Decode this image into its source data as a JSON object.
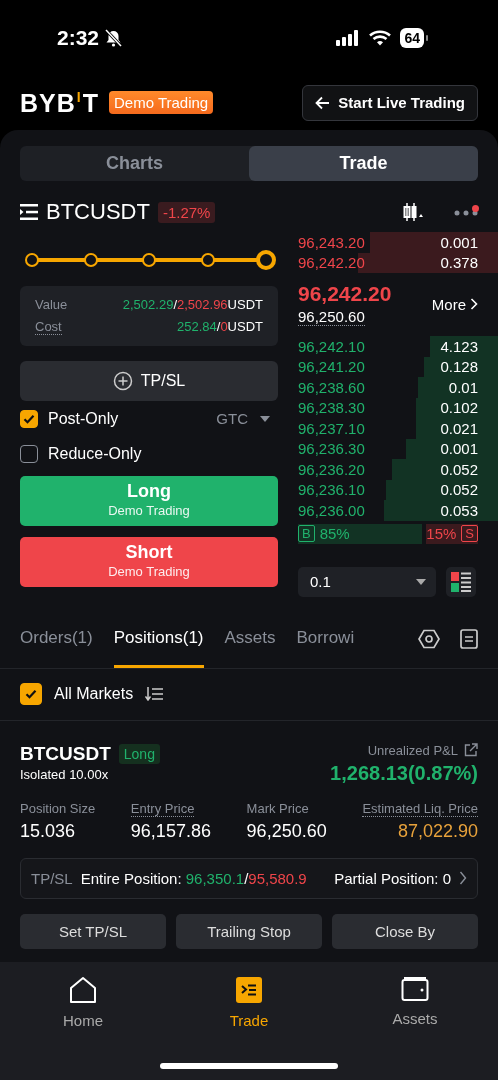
{
  "status_bar": {
    "time": "2:32",
    "battery": "64"
  },
  "header": {
    "logo": [
      "BYB",
      "I",
      "T"
    ],
    "badge": "Demo Trading",
    "live_button": "Start Live Trading"
  },
  "view_tabs": [
    {
      "label": "Charts",
      "selected": false
    },
    {
      "label": "Trade",
      "selected": true
    }
  ],
  "symbol": {
    "name": "BTCUSDT",
    "change": "-1.27%",
    "menu_alert": true
  },
  "order_form": {
    "leverage": {
      "level": 1
    },
    "summary": [
      {
        "label": "Value",
        "dotted": false,
        "values": [
          {
            "text": "2,502.29",
            "color": "#20b26c"
          },
          {
            "text": "/"
          },
          {
            "text": "2,502.96",
            "color": "#ef454a"
          },
          {
            "text": "USDT"
          }
        ]
      },
      {
        "label": "Cost",
        "dotted": true,
        "values": [
          {
            "text": "252.84",
            "color": "#20b26c"
          },
          {
            "text": "/"
          },
          {
            "text": "0",
            "color": "#ef454a"
          },
          {
            "text": "USDT"
          }
        ]
      }
    ],
    "tpsl": "TP/SL",
    "options": [
      {
        "label": "Post-Only",
        "checked": true
      },
      {
        "label": "Reduce-Only",
        "checked": false
      }
    ],
    "time_in_force": "GTC",
    "long": {
      "label": "Long",
      "sub": "Demo Trading"
    },
    "short": {
      "label": "Short",
      "sub": "Demo Trading"
    }
  },
  "order_book": {
    "asks": [
      {
        "price": "96,243.20",
        "qty": "0.001"
      },
      {
        "price": "96,242.20",
        "qty": "0.378"
      }
    ],
    "last_price": "96,242.20",
    "mark_price": "96,250.60",
    "more": "More",
    "bids": [
      {
        "price": "96,242.10",
        "qty": "4.123"
      },
      {
        "price": "96,241.20",
        "qty": "0.128"
      },
      {
        "price": "96,238.60",
        "qty": "0.01"
      },
      {
        "price": "96,238.30",
        "qty": "0.102"
      },
      {
        "price": "96,237.10",
        "qty": "0.021"
      },
      {
        "price": "96,236.30",
        "qty": "0.001"
      },
      {
        "price": "96,236.20",
        "qty": "0.052"
      },
      {
        "price": "96,236.10",
        "qty": "0.052"
      },
      {
        "price": "96,236.00",
        "qty": "0.053"
      }
    ],
    "buy_tag": "B",
    "buy_ratio": "85%",
    "sell_ratio": "15%",
    "sell_tag": "S",
    "precision": "0.1"
  },
  "position_tabs": [
    {
      "label": "Orders(1)",
      "selected": false
    },
    {
      "label": "Positions(1)",
      "selected": true
    },
    {
      "label": "Assets",
      "selected": false
    },
    {
      "label": "Borrowi",
      "selected": false
    }
  ],
  "filter": {
    "label": "All Markets",
    "checked": true
  },
  "position": {
    "symbol": "BTCUSDT",
    "side": "Long",
    "margin": "Isolated 10.00x",
    "pnl_label": "Unrealized P&L",
    "pnl": "1,268.13(0.87%)",
    "stats": [
      {
        "label": "Position Size",
        "value": "15.036",
        "dotted": false
      },
      {
        "label": "Entry Price",
        "value": "96,157.86",
        "dotted": true
      },
      {
        "label": "Mark Price",
        "value": "96,250.60",
        "dotted": false
      },
      {
        "label": "Estimated Liq. Price",
        "value": "87,022.90",
        "dotted": true,
        "color": "#e8a23b"
      }
    ],
    "tpsl": {
      "label": "TP/SL",
      "entire": "Entire Position:",
      "tp": "96,350.1",
      "separator": "/",
      "sl": "95,580.9",
      "partial": "Partial Position: 0"
    },
    "actions": [
      "Set TP/SL",
      "Trailing Stop",
      "Close By"
    ]
  },
  "nav": [
    {
      "label": "Home",
      "selected": false
    },
    {
      "label": "Trade",
      "selected": true
    },
    {
      "label": "Assets",
      "selected": false
    }
  ]
}
